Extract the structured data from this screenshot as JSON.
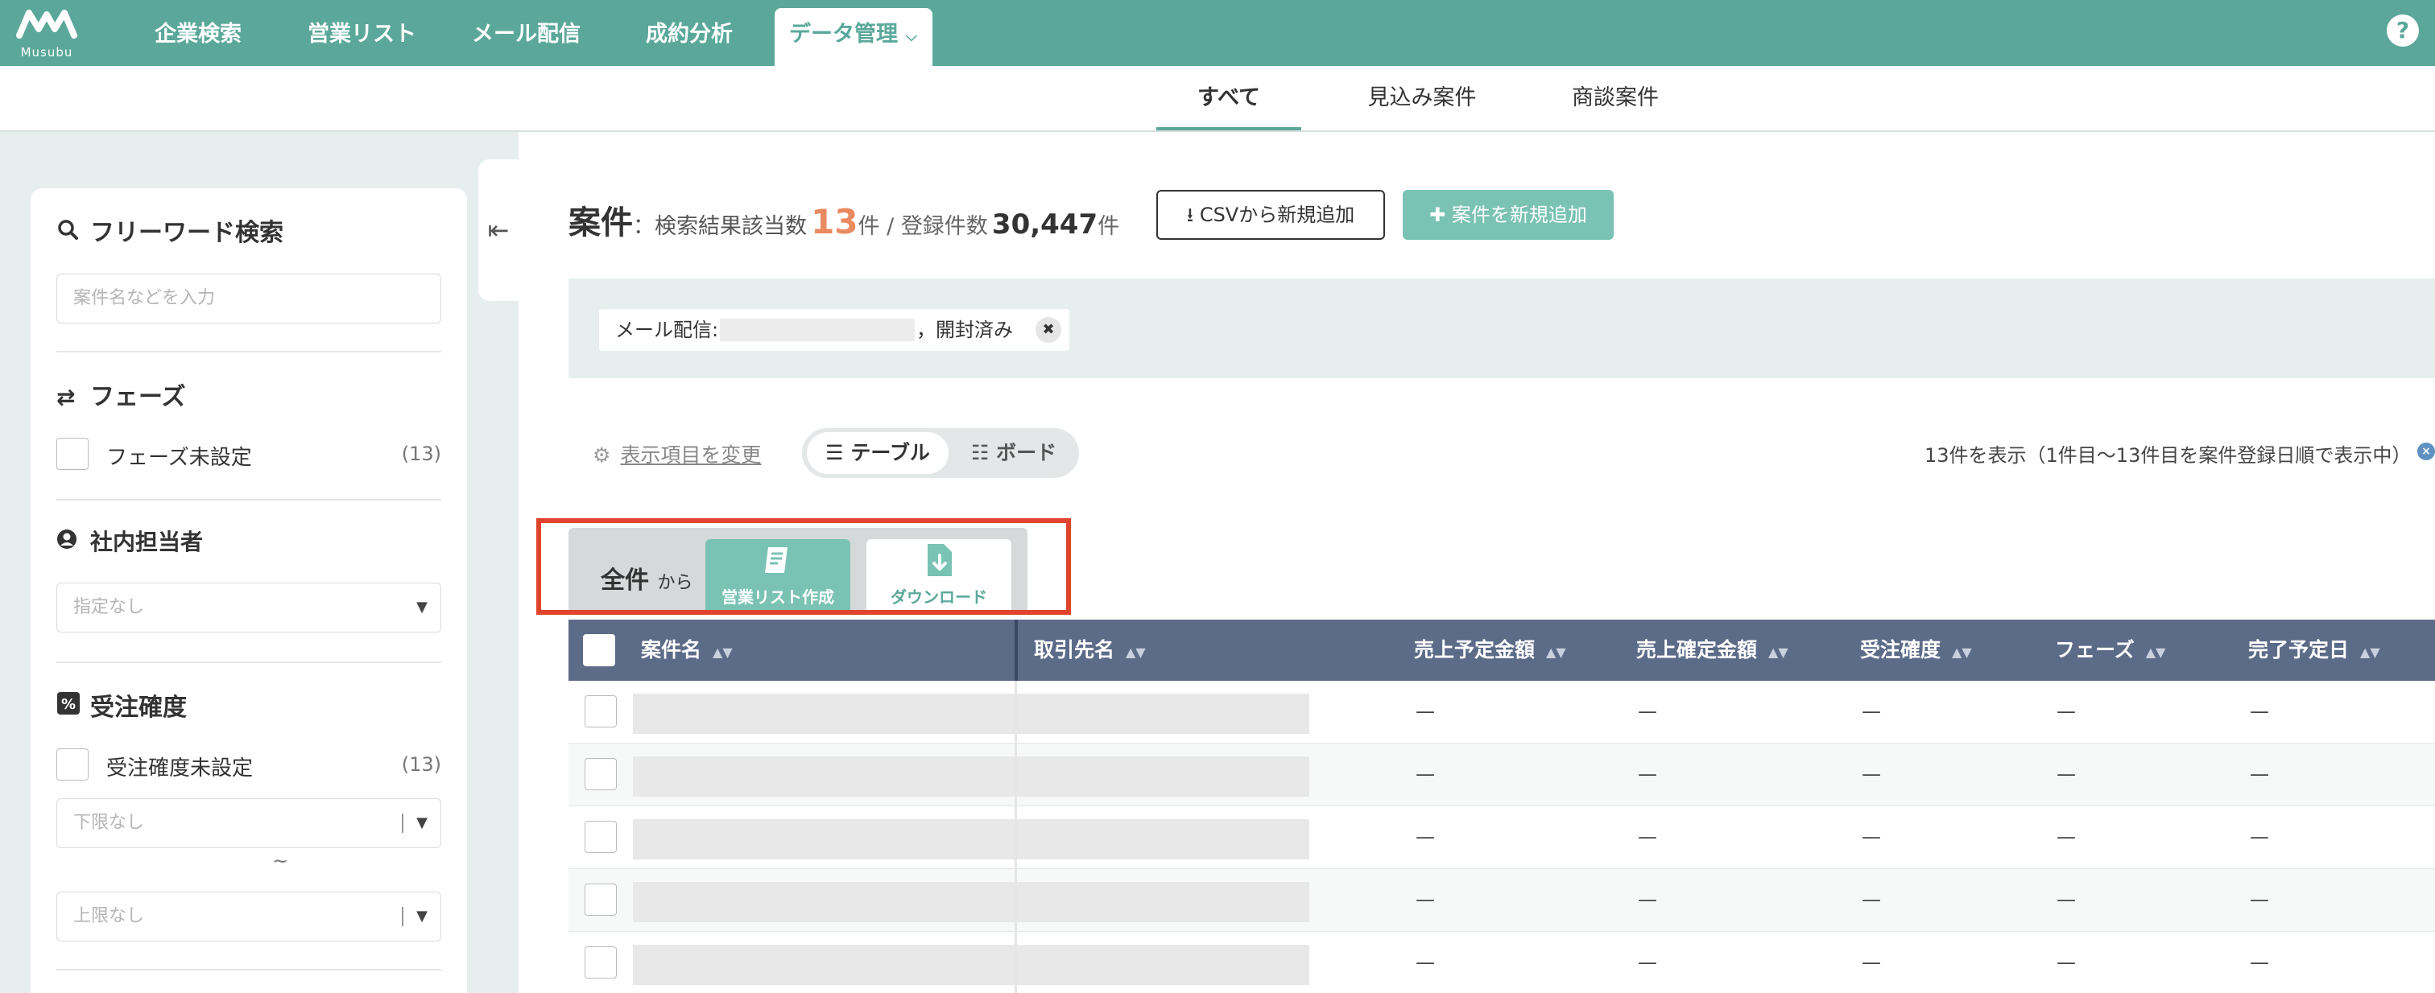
{
  "app": {
    "logo_text": "Musubu",
    "nav": [
      {
        "label": "企業検索"
      },
      {
        "label": "営業リスト"
      },
      {
        "label": "メール配信"
      },
      {
        "label": "成約分析"
      },
      {
        "label": "データ管理"
      }
    ],
    "help": "?"
  },
  "subnav": {
    "tabs": [
      {
        "label": "すべて"
      },
      {
        "label": "見込み案件"
      },
      {
        "label": "商談案件"
      }
    ]
  },
  "sidebar": {
    "freeword": {
      "title": "フリーワード検索",
      "placeholder": "案件名などを入力"
    },
    "phase": {
      "title": "フェーズ",
      "unset_label": "フェーズ未設定",
      "unset_count": "(13)"
    },
    "owner": {
      "title": "社内担当者",
      "placeholder": "指定なし"
    },
    "probability": {
      "title": "受注確度",
      "unset_label": "受注確度未設定",
      "unset_count": "(13)",
      "lower_placeholder": "下限なし",
      "tilde": "~",
      "upper_placeholder": "上限なし"
    }
  },
  "main": {
    "heading": {
      "title": "案件",
      "colon": "：",
      "result_label": "検索結果該当数",
      "result_count": "13",
      "unit": "件",
      "slash": " / ",
      "registered_label": "登録件数",
      "registered_count": "30,447"
    },
    "buttons": {
      "csv_add": "CSVから新規追加",
      "add_case": "案件を新規追加"
    },
    "filter_chip": {
      "prefix": "メール配信:",
      "suffix": "，開封済み"
    },
    "settings_link": "表示項目を変更",
    "view_toggle": {
      "table": "テーブル",
      "board": "ボード"
    },
    "result_text": "13件を表示（1件目〜13件目を案件登録日順で表示中）",
    "bulk": {
      "all_label": "全件",
      "from_label": "から",
      "create_list": "営業リスト作成",
      "download": "ダウンロード"
    },
    "table": {
      "columns": [
        "案件名",
        "取引先名",
        "売上予定金額",
        "売上確定金額",
        "受注確度",
        "フェーズ",
        "完了予定日"
      ],
      "rows": [
        {
          "cells": [
            "—",
            "—",
            "—",
            "—",
            "—"
          ]
        },
        {
          "cells": [
            "—",
            "—",
            "—",
            "—",
            "—"
          ]
        },
        {
          "cells": [
            "—",
            "—",
            "—",
            "—",
            "—"
          ]
        },
        {
          "cells": [
            "—",
            "—",
            "—",
            "—",
            "—"
          ]
        },
        {
          "cells": [
            "—",
            "—",
            "—",
            "—",
            "—"
          ]
        }
      ]
    }
  },
  "colors": {
    "brand": "#5ba89a",
    "accent_count": "#ea8a60",
    "table_header": "#5c6b88",
    "highlight": "#e0442d"
  },
  "icons": [
    "logo-icon",
    "chevron-down-icon",
    "help-icon",
    "search-icon",
    "swap-arrows-icon",
    "user-circle-icon",
    "percent-icon",
    "collapse-left-icon",
    "download-icon",
    "plus-icon",
    "close-icon",
    "gear-icon",
    "list-icon",
    "board-icon",
    "notebook-icon",
    "file-download-icon",
    "sort-icon"
  ]
}
